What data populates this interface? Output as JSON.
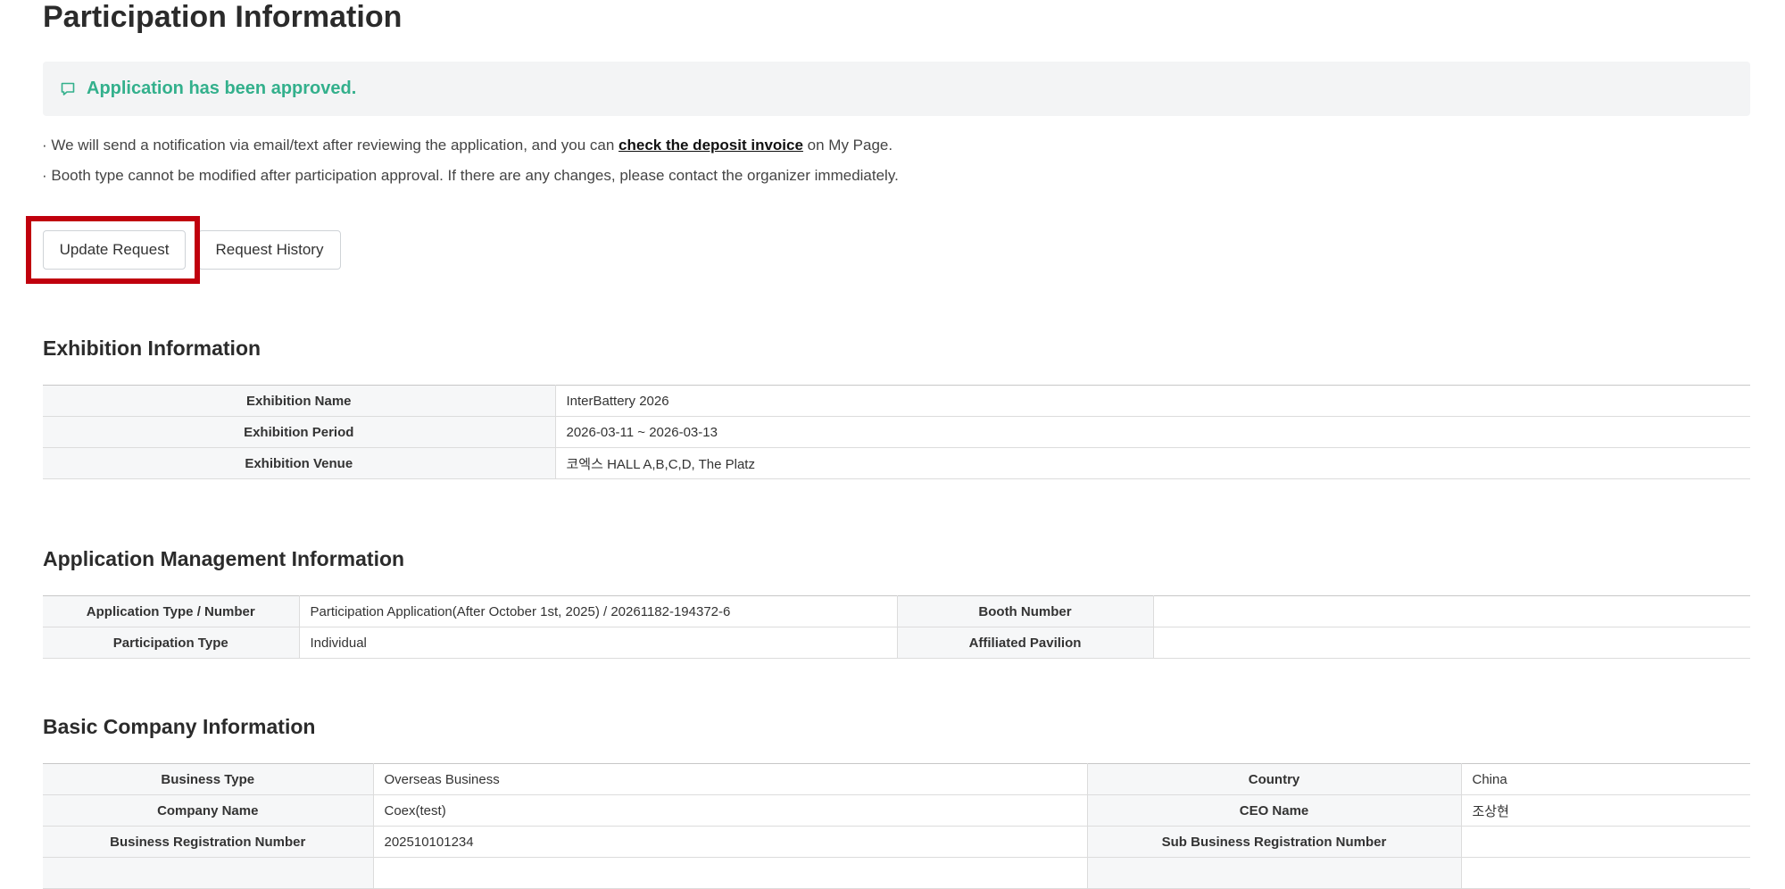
{
  "page_title": "Participation Information",
  "alert": {
    "icon": "comment-icon",
    "text": "Application has been approved.",
    "color": "#33b08c"
  },
  "notices": {
    "line1_prefix": "· We will send a notification via email/text after reviewing the application, and you can ",
    "line1_link": "check the deposit invoice",
    "line1_suffix": " on My Page.",
    "line2": "· Booth type cannot be modified after participation approval. If there are any changes, please contact the organizer immediately."
  },
  "buttons": {
    "update_request": "Update Request",
    "request_history": "Request History"
  },
  "exhibition": {
    "title": "Exhibition Information",
    "rows": [
      {
        "label": "Exhibition Name",
        "value": "InterBattery 2026"
      },
      {
        "label": "Exhibition Period",
        "value": "2026-03-11 ~ 2026-03-13"
      },
      {
        "label": "Exhibition Venue",
        "value": "코엑스 HALL A,B,C,D, The Platz"
      }
    ]
  },
  "application": {
    "title": "Application Management Information",
    "rows": [
      {
        "label1": "Application Type / Number",
        "value1": "Participation Application(After October 1st, 2025) / 20261182-194372-6",
        "label2": "Booth Number",
        "value2": ""
      },
      {
        "label1": "Participation Type",
        "value1": "Individual",
        "label2": "Affiliated Pavilion",
        "value2": ""
      }
    ]
  },
  "company": {
    "title": "Basic Company Information",
    "rows": [
      {
        "label1": "Business Type",
        "value1": "Overseas Business",
        "label2": "Country",
        "value2": "China"
      },
      {
        "label1": "Company Name",
        "value1": "Coex(test)",
        "label2": "CEO Name",
        "value2": "조상현"
      },
      {
        "label1": "Business Registration Number",
        "value1": "202510101234",
        "label2": "Sub Business Registration Number",
        "value2": ""
      },
      {
        "label1": "",
        "value1": "",
        "label2": "",
        "value2": ""
      }
    ]
  },
  "colors": {
    "highlight": "#c0000d",
    "label_bg": "#f6f7f8",
    "alert_bg": "#f3f4f5"
  }
}
